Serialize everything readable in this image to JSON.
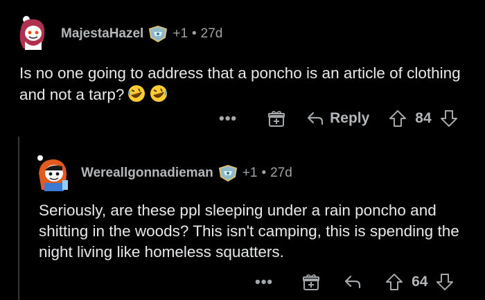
{
  "comments": [
    {
      "username": "MajestaHazel",
      "award_count": "+1",
      "separator": "•",
      "age": "27d",
      "body": "Is no one going to address that a poncho is an article of clothing and not a tarp?",
      "emoji_icons": [
        "rolling-on-floor-laughing-icon",
        "rolling-on-floor-laughing-icon"
      ],
      "actions": {
        "more": "•••",
        "reply": "Reply",
        "votes": "84"
      }
    },
    {
      "username": "Wereallgonnadieman",
      "award_count": "+1",
      "separator": "•",
      "age": "27d",
      "body": "Seriously, are these ppl sleeping under a rain poncho and shitting in the woods? This isn't camping, this is spending the night living like homeless squatters.",
      "actions": {
        "more": "•••",
        "votes": "64"
      }
    }
  ],
  "colors": {
    "background": "#000000",
    "username": "#b4b7ba",
    "meta": "#a0a3a6",
    "body_text": "#e6e8ea",
    "thread_line": "#343536"
  }
}
